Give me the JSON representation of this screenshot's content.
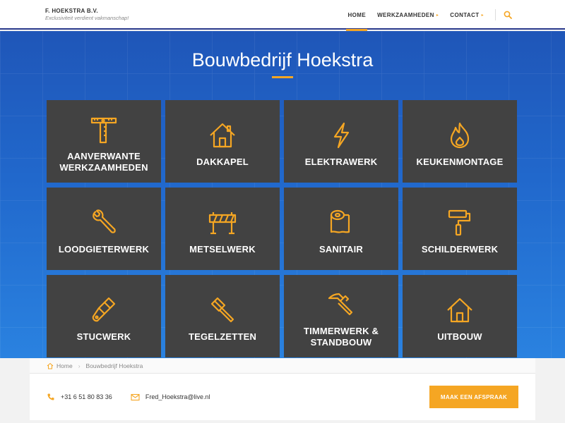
{
  "brand": {
    "name": "F. HOEKSTRA B.V.",
    "tagline": "Exclusiviteit verdient vakmanschap!"
  },
  "nav": {
    "items": [
      {
        "label": "HOME",
        "active": true,
        "has_submenu": false
      },
      {
        "label": "WERKZAAMHEDEN",
        "active": false,
        "has_submenu": true
      },
      {
        "label": "CONTACT",
        "active": false,
        "has_submenu": true
      }
    ],
    "search_icon": "search-icon"
  },
  "hero": {
    "title": "Bouwbedrijf Hoekstra"
  },
  "tiles": [
    {
      "label": "AANVERWANTE\nWERKZAAMHEDEN",
      "icon": "ruler-square-icon"
    },
    {
      "label": "DAKKAPEL",
      "icon": "house-icon"
    },
    {
      "label": "ELEKTRAWERK",
      "icon": "lightning-icon"
    },
    {
      "label": "KEUKENMONTAGE",
      "icon": "flame-icon"
    },
    {
      "label": "LOODGIETERWERK",
      "icon": "wrench-icon"
    },
    {
      "label": "METSELWERK",
      "icon": "barrier-icon"
    },
    {
      "label": "SANITAIR",
      "icon": "toilet-paper-icon"
    },
    {
      "label": "SCHILDERWERK",
      "icon": "paint-roller-icon"
    },
    {
      "label": "STUCWERK",
      "icon": "putty-knife-icon"
    },
    {
      "label": "TEGELZETTEN",
      "icon": "mallet-icon"
    },
    {
      "label": "TIMMERWERK &\nSTANDBOUW",
      "icon": "hammer-icon"
    },
    {
      "label": "UITBOUW",
      "icon": "house-outline-icon"
    }
  ],
  "breadcrumb": {
    "home": "Home",
    "current": "Bouwbedrijf Hoekstra"
  },
  "contact": {
    "phone": "+31 6 51 80 83 36",
    "email": "Fred_Hoekstra@live.nl",
    "cta_label": "MAAK EEN AFSPRAAK"
  },
  "colors": {
    "accent": "#f5a623",
    "tile": "#424242",
    "hero_top": "#1f56b8",
    "hero_bottom": "#2a82e0"
  }
}
